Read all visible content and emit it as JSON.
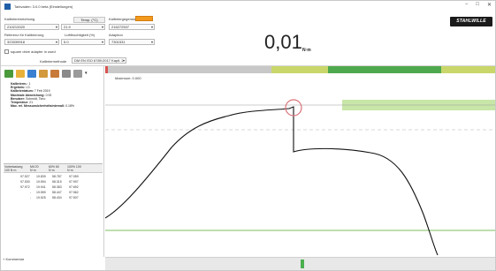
{
  "window": {
    "title": "Tarkvaden: 3.0.0 beta (Einstellungen)",
    "controls": [
      "−",
      "□",
      "✕"
    ]
  },
  "header": {
    "kalibriereinrichtung_label": "Kalibriereinrichtung",
    "kalibriereinrichtung_value": "210213320",
    "temp_button": "Temp. (°C)",
    "temp_value": "21.9",
    "referenz_label": "Referenz für Kalibrierung",
    "referenz_value": "323339918",
    "luftfeuchtigkeit_label": "Luftfeuchtigkeit (%)",
    "luftfeuchtigkeit_value": "5.0",
    "kalibriergegenstand_label": "Kalibriergegenstand",
    "kalibriergegenstand_value": "216272507",
    "adaption_label": "Adaption",
    "adaption_value": "7301531",
    "square_drive_label": "square drive adapter in used",
    "kalibriermethode_label": "Kalibriermethode",
    "kalibriermethode_value": "DM EN ISO 6789:2017 Kapit. 2",
    "reading": "0,01",
    "unit": "N·m",
    "logo_text": "STAHLWILLE"
  },
  "left_panel": {
    "info_lines": [
      {
        "key": "Kalibrierm.:",
        "value": "1"
      },
      {
        "key": "Ergebnis:",
        "value": "i.O."
      },
      {
        "key": "Kalibrierdatum:",
        "value": "7 Feb 2019"
      },
      {
        "key": "Maximale Abweichung:",
        "value": "0.92"
      },
      {
        "key": "Benutzer:",
        "value": "Schmidt, Timo"
      },
      {
        "key": "Temperatur:",
        "value": "21"
      },
      {
        "key": "Max. rel. Messunsicherheitsintervall:",
        "value": "0.18%"
      }
    ],
    "table_headers": [
      "Vorbelastung 100 N·m",
      "Mit 20 N·m",
      "60% 60 N·m",
      "100% 100 N·m"
    ],
    "table_rows": [
      [
        "97.527",
        "19.839",
        "58.787",
        "97.059"
      ],
      [
        "97.530",
        "19.594",
        "58.315",
        "97.997"
      ],
      [
        "97.972",
        "19.941",
        "58.383",
        "97.692"
      ],
      [
        "-",
        "19.559",
        "58.447",
        "97.562"
      ],
      [
        "-",
        "19.525",
        "58.434",
        "97.507"
      ]
    ],
    "comment_label": "+ Kommentar"
  },
  "graph": {
    "max_label": "Maximum: 0.000"
  },
  "colors": {
    "accent": "#f39a1e",
    "green": "#4caf50",
    "tolerance_band": "#c8e6a8",
    "limit_line": "#7cbf5c",
    "marker": "#d9737a",
    "topbar_left": "#c8c8c8",
    "topbar_yellow": "#c9d66a",
    "topbar_green": "#4ea94e"
  }
}
